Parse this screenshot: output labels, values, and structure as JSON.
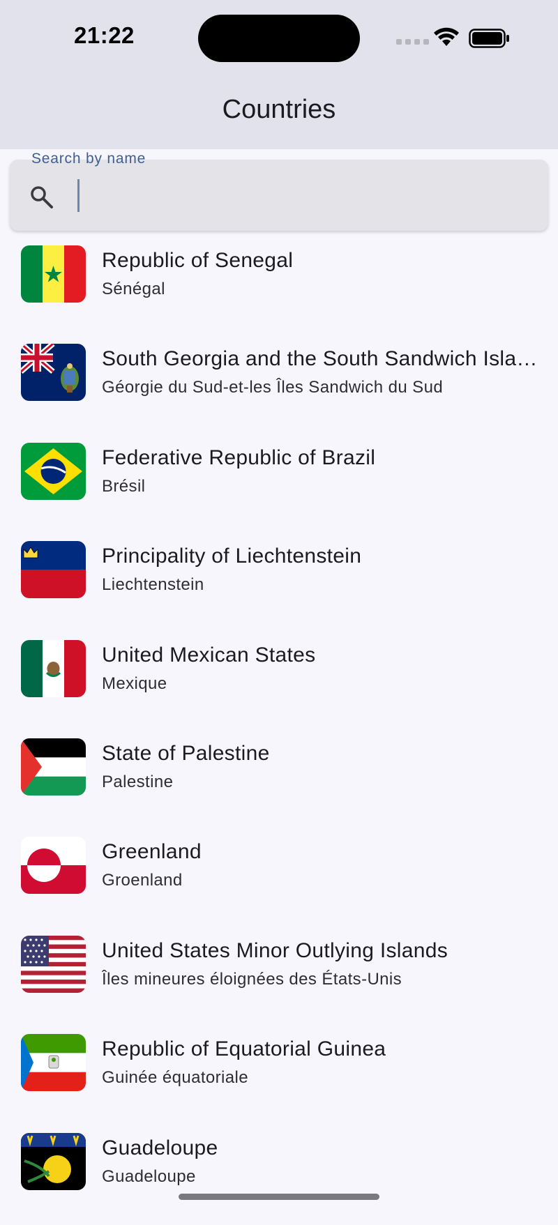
{
  "status_bar": {
    "time": "21:22"
  },
  "app_bar": {
    "title": "Countries"
  },
  "search": {
    "label": "Search by name",
    "value": "",
    "placeholder": ""
  },
  "countries": [
    {
      "name": "Republic of Senegal",
      "native": "Sénégal",
      "flag": "senegal-flag-icon"
    },
    {
      "name": "South Georgia and the South Sandwich Islands",
      "native": "Géorgie du Sud-et-les Îles Sandwich du Sud",
      "flag": "south-georgia-flag-icon"
    },
    {
      "name": "Federative Republic of Brazil",
      "native": "Brésil",
      "flag": "brazil-flag-icon"
    },
    {
      "name": "Principality of Liechtenstein",
      "native": "Liechtenstein",
      "flag": "liechtenstein-flag-icon"
    },
    {
      "name": "United Mexican States",
      "native": "Mexique",
      "flag": "mexico-flag-icon"
    },
    {
      "name": "State of Palestine",
      "native": "Palestine",
      "flag": "palestine-flag-icon"
    },
    {
      "name": "Greenland",
      "native": "Groenland",
      "flag": "greenland-flag-icon"
    },
    {
      "name": "United States Minor Outlying Islands",
      "native": "Îles mineures éloignées des États-Unis",
      "flag": "us-minor-islands-flag-icon"
    },
    {
      "name": "Republic of Equatorial Guinea",
      "native": "Guinée équatoriale",
      "flag": "equatorial-guinea-flag-icon"
    },
    {
      "name": "Guadeloupe",
      "native": "Guadeloupe",
      "flag": "guadeloupe-flag-icon"
    }
  ],
  "colors": {
    "app_bar": "#e1e2ec",
    "background": "#f6f6fc",
    "search_label": "#3f5f90"
  }
}
